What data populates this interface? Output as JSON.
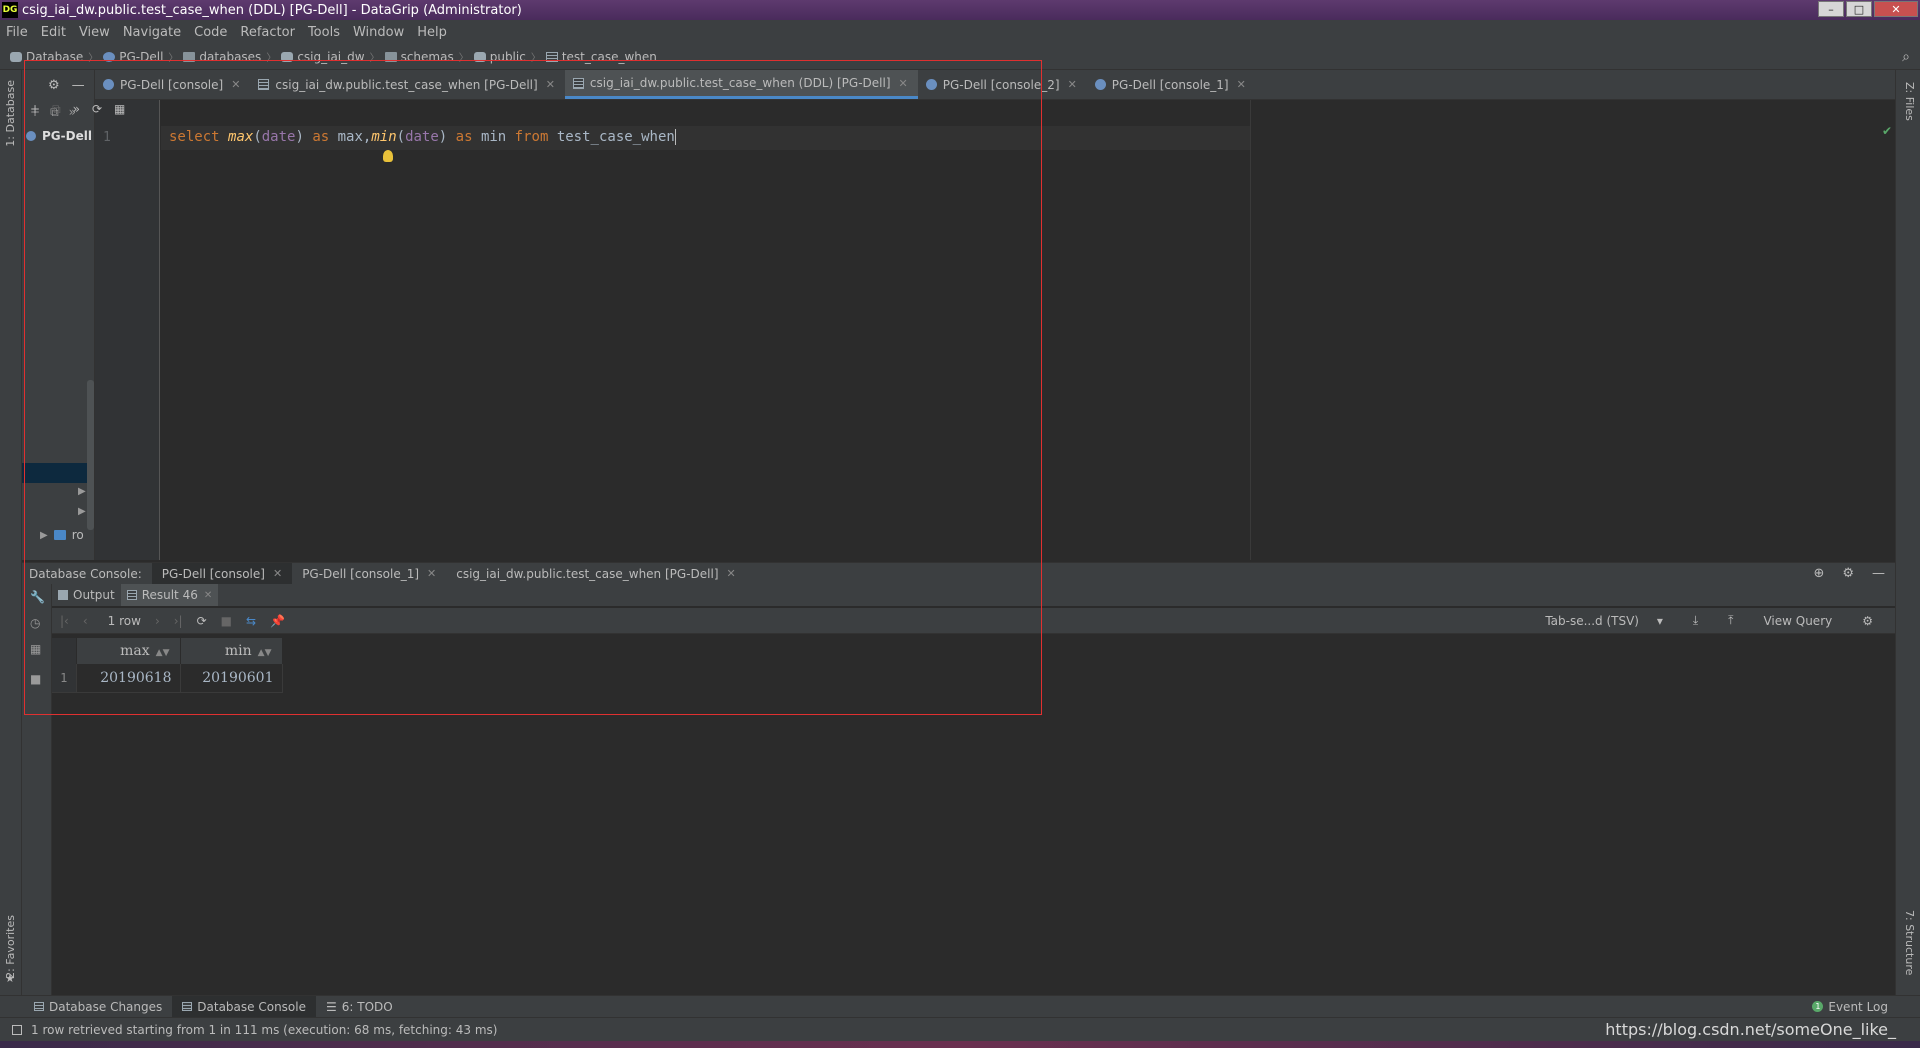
{
  "window": {
    "title": "csig_iai_dw.public.test_case_when (DDL) [PG-Dell] - DataGrip (Administrator)",
    "logo": "DG"
  },
  "menu": [
    "File",
    "Edit",
    "View",
    "Navigate",
    "Code",
    "Refactor",
    "Tools",
    "Window",
    "Help"
  ],
  "breadcrumb": [
    "Database",
    "PG-Dell",
    "databases",
    "csig_iai_dw",
    "schemas",
    "public",
    "test_case_when"
  ],
  "left_strip": {
    "database_label": "1: Database",
    "favorites_label": "2: Favorites"
  },
  "right_strip": {
    "files_label": "Z: Files",
    "structure_label": "7: Structure"
  },
  "db_panel": {
    "root": "PG-Dell",
    "tree_item": "ro"
  },
  "editor_tabs": [
    {
      "label": "PG-Dell [console]",
      "active": false
    },
    {
      "label": "csig_iai_dw.public.test_case_when [PG-Dell]",
      "active": false
    },
    {
      "label": "csig_iai_dw.public.test_case_when (DDL) [PG-Dell]",
      "active": true
    },
    {
      "label": "PG-Dell [console_2]",
      "active": false
    },
    {
      "label": "PG-Dell [console_1]",
      "active": false
    }
  ],
  "editor": {
    "line_number": "1",
    "tokens": {
      "t1": "select ",
      "t2": "max",
      "t3": "(",
      "t4": "date",
      "t5": ") ",
      "t6": "as ",
      "t7": "max,",
      "t8": "min",
      "t9": "(",
      "t10": "date",
      "t11": ") ",
      "t12": "as ",
      "t13": "min ",
      "t14": "from ",
      "t15": "test_case_when"
    }
  },
  "console": {
    "title": "Database Console:",
    "tabs": [
      "PG-Dell [console]",
      "PG-Dell [console_1]",
      "csig_iai_dw.public.test_case_when [PG-Dell]"
    ]
  },
  "results": {
    "tabs": [
      "Output",
      "Result 46"
    ],
    "row_selector": "1 row",
    "export_format": "Tab-se...d (TSV)",
    "view_query": "View Query",
    "columns": [
      "max",
      "min"
    ],
    "rows": [
      {
        "num": "1",
        "max": "20190618",
        "min": "20190601"
      }
    ]
  },
  "bottom_tools": {
    "database_changes": "Database Changes",
    "database_console": "Database Console",
    "todo": "6: TODO",
    "event_log": "Event Log"
  },
  "status": {
    "message": "1 row retrieved starting from 1 in 111 ms (execution: 68 ms, fetching: 43 ms)",
    "watermark": "https://blog.csdn.net/someOne_like_"
  }
}
